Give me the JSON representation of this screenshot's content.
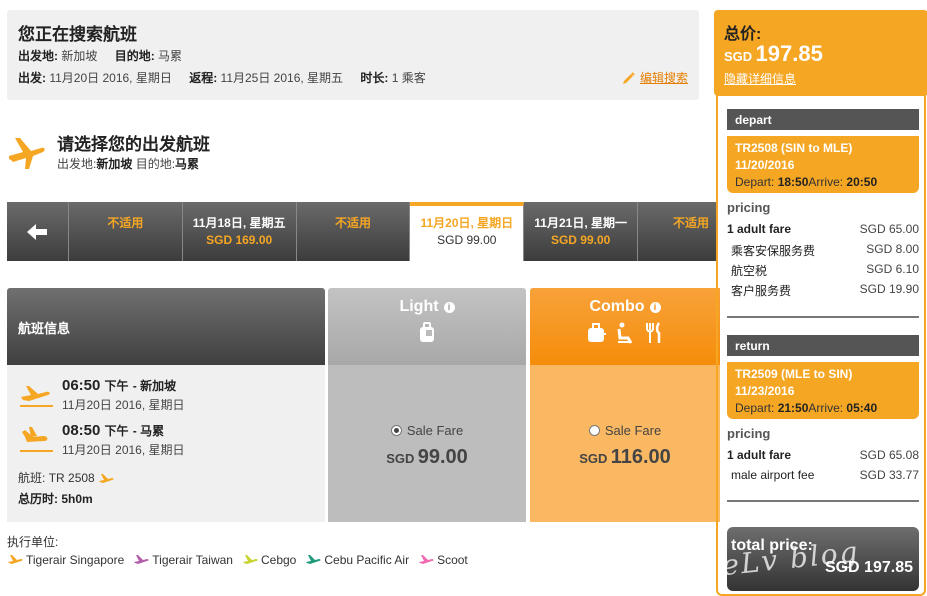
{
  "search": {
    "title": "您正在搜索航班",
    "from_label": "出发地:",
    "from_value": "新加坡",
    "to_label": "目的地:",
    "to_value": "马累",
    "depart_label": "出发:",
    "depart_value": "11月20日 2016, 星期日",
    "return_label": "返程:",
    "return_value": "11月25日 2016, 星期五",
    "duration_label": "时长:",
    "duration_value": "1 乘客",
    "edit_label": "编辑搜索"
  },
  "departure": {
    "heading": "请选择您的出发航班",
    "from_label": "出发地:",
    "from_value": "新加坡",
    "to_label": "目的地:",
    "to_value": "马累"
  },
  "dates": [
    {
      "line1": "不适用",
      "line2": ""
    },
    {
      "line1": "11月18日, 星期五",
      "line2": "SGD 169.00"
    },
    {
      "line1": "不适用",
      "line2": ""
    },
    {
      "line1": "11月20日, 星期日",
      "line2": "SGD 99.00"
    },
    {
      "line1": "11月21日, 星期一",
      "line2": "SGD 99.00"
    },
    {
      "line1": "不适用",
      "line2": ""
    }
  ],
  "fare_table": {
    "info_header": "航班信息",
    "segments": [
      {
        "time": "06:50",
        "ampm": "下午",
        "city": "- 新加坡",
        "date": "11月20日 2016, 星期日"
      },
      {
        "time": "08:50",
        "ampm": "下午",
        "city": "- 马累",
        "date": "11月20日 2016, 星期日"
      }
    ],
    "flight_label": "航班:",
    "flight_value": "TR 2508",
    "duration_label": "总历时:",
    "duration_value": "5h0m",
    "light": {
      "title": "Light",
      "option": "Sale Fare",
      "currency": "SGD",
      "price": "99.00"
    },
    "combo": {
      "title": "Combo",
      "option": "Sale Fare",
      "currency": "SGD",
      "price": "116.00"
    }
  },
  "operators": {
    "label": "执行单位:",
    "items": [
      {
        "name": "Tigerair Singapore",
        "color": "#f5a623"
      },
      {
        "name": "Tigerair Taiwan",
        "color": "#b35ea8"
      },
      {
        "name": "Cebgo",
        "color": "#c7d32e"
      },
      {
        "name": "Cebu Pacific Air",
        "color": "#1f9a7a"
      },
      {
        "name": "Scoot",
        "color": "#f06bb0"
      }
    ]
  },
  "summary": {
    "total_label": "总价:",
    "currency": "SGD",
    "amount": "197.85",
    "hide_details": "隐藏详细信息",
    "depart": {
      "header": "depart",
      "flight": "TR2508 (SIN to MLE)",
      "date": "11/20/2016",
      "depart_label": "Depart:",
      "depart_time": "18:50",
      "arrive_label": "Arrive:",
      "arrive_time": "20:50",
      "pricing_label": "pricing",
      "rows": [
        {
          "name": "1 adult fare",
          "value": "SGD 65.00"
        },
        {
          "name": "乘客安保服务费",
          "value": "SGD 8.00"
        },
        {
          "name": "航空税",
          "value": "SGD 6.10"
        },
        {
          "name": "客户服务费",
          "value": "SGD 19.90"
        }
      ]
    },
    "return": {
      "header": "return",
      "flight": "TR2509 (MLE to SIN)",
      "date": "11/23/2016",
      "depart_label": "Depart:",
      "depart_time": "21:50",
      "arrive_label": "Arrive:",
      "arrive_time": "05:40",
      "pricing_label": "pricing",
      "rows": [
        {
          "name": "1 adult fare",
          "value": "SGD 65.08"
        },
        {
          "name": "male airport fee",
          "value": "SGD 33.77"
        }
      ]
    },
    "total_price_label": "total price:",
    "total_price_value": "SGD 197.85",
    "watermark": "eLv blog"
  },
  "colors": {
    "accent": "#f5a623",
    "dark": "#3d3d3d"
  }
}
